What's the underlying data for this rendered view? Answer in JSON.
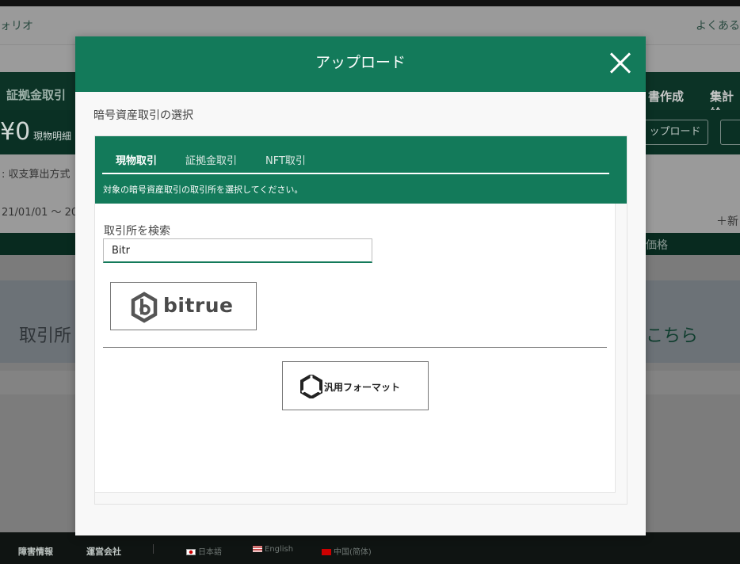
{
  "background": {
    "top_left": "ォリオ",
    "top_right": "よくある",
    "nav_left": "証拠金取引",
    "nav_right_1": "書作成",
    "nav_right_2": "集計給",
    "amount": "¥0",
    "amount_label": "現物明細",
    "upload_button": "ップロード",
    "line1": ": 収支算出方式",
    "line2": "21/01/01 〜 20",
    "add_link": "＋新",
    "table_header": "価格",
    "banner_left": "取引所",
    "banner_right": "こちら"
  },
  "footer": {
    "link1": "障害情報",
    "link2": "運営会社",
    "lang_ja": "日本語",
    "lang_en": "English",
    "lang_zh": "中国(简体)"
  },
  "modal": {
    "title": "アップロード",
    "section_label": "暗号資産取引の選択",
    "tabs": [
      {
        "label": "現物取引",
        "active": true
      },
      {
        "label": "証拠金取引",
        "active": false
      },
      {
        "label": "NFT取引",
        "active": false
      }
    ],
    "note": "対象の暗号資産取引の取引所を選択してください。",
    "search_label": "取引所を検索",
    "search_value": "Bitr",
    "exchange_result": "bitrue",
    "generic_format": "汎用フォーマット"
  },
  "colors": {
    "brand_green": "#137a5a",
    "overlay_dark": "#0c3326"
  }
}
